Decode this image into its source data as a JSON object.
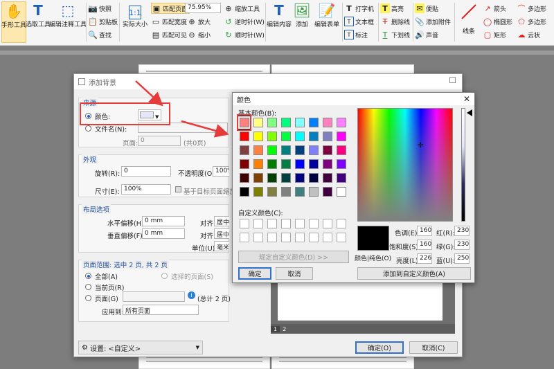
{
  "ribbon": {
    "hand": "手形工具",
    "select": "选取工具",
    "edit_annot": "编辑注释工具",
    "snapshot": "快照",
    "clipboard": "剪贴板",
    "find": "查找",
    "actual": "实际大小",
    "fit_page": "匹配页面",
    "fit_width": "匹配宽度",
    "fit_visible": "匹配可见",
    "zoom_val": "75.95%",
    "zoom_tool": "缩放工具",
    "zoom_in": "放大",
    "zoom_out": "缩小",
    "ccw": "逆时针(W)",
    "cw": "顺时针(W)",
    "edit_content": "编辑内容",
    "add": "添加",
    "edit_form": "编辑表单",
    "typewriter": "打字机",
    "textbox": "文本框",
    "callout": "标注",
    "highlight": "高亮",
    "strike": "删除线",
    "underline": "下划线",
    "note": "便贴",
    "attach": "添加附件",
    "sound": "声音",
    "line": "线条",
    "arrow": "箭头",
    "ellipse": "椭圆形",
    "rect": "矩形",
    "polygon": "多边形",
    "polyline": "多边形",
    "cloud": "云状"
  },
  "bg_dialog": {
    "title": "添加背景",
    "source": "来源",
    "color": "颜色:",
    "filename": "文件名(N):",
    "page": "页面:",
    "page_val": "0",
    "page_total": "(共0页)",
    "appearance": "外观",
    "rotate": "旋转(R):",
    "rotate_val": "0",
    "opacity": "不透明度(O):",
    "opacity_val": "100%",
    "size": "尺寸(E):",
    "size_val": "100%",
    "scale_target": "基于目标页面缩放",
    "layout": "布局选项",
    "hoffset": "水平偏移(H):",
    "hoffset_val": "0 mm",
    "voffset": "垂直偏移(F):",
    "voffset_val": "0 mm",
    "align1": "对齐:",
    "align1_val": "居中",
    "align2": "对齐:",
    "align2_val": "居中",
    "unit": "单位(U):",
    "unit_val": "毫米",
    "range": "页面范围: 选中 2 页, 共 2 页",
    "all": "全部(A)",
    "selected": "选择的页面(S)",
    "current": "当前页(R)",
    "pages": "页面(G)",
    "pages_total": "(总计 2 页)",
    "apply": "应用到:",
    "apply_val": "所有页面",
    "settings": "设置:",
    "settings_val": "<自定义>",
    "ok": "确定(O)",
    "cancel": "取消(C)",
    "thumb1": "1",
    "thumb2": "2"
  },
  "color_dialog": {
    "title": "颜色",
    "basic": "基本颜色(B):",
    "custom": "自定义颜色(C):",
    "define": "规定自定义颜色(D) >>",
    "ok": "确定",
    "cancel": "取消",
    "solid": "颜色|纯色(O)",
    "hue_l": "色调(E):",
    "hue": "160",
    "sat_l": "饱和度(S):",
    "sat": "160",
    "lum_l": "亮度(L):",
    "lum": "226",
    "red_l": "红(R):",
    "red": "230",
    "green_l": "绿(G):",
    "green": "230",
    "blue_l": "蓝(U):",
    "blue": "250",
    "add_custom": "添加到自定义颜色(A)",
    "swatches": [
      "#ff8080",
      "#ffff80",
      "#80ff80",
      "#00ff80",
      "#80ffff",
      "#0080ff",
      "#ff80c0",
      "#ff80ff",
      "#ff0000",
      "#ffff00",
      "#80ff00",
      "#00ff40",
      "#00ffff",
      "#0080c0",
      "#8080c0",
      "#ff00ff",
      "#804040",
      "#ff8040",
      "#00ff00",
      "#008080",
      "#004080",
      "#8080ff",
      "#800040",
      "#ff0080",
      "#800000",
      "#ff8000",
      "#008000",
      "#008040",
      "#0000ff",
      "#0000a0",
      "#800080",
      "#8000ff",
      "#400000",
      "#804000",
      "#004000",
      "#004040",
      "#000080",
      "#000040",
      "#400040",
      "#400080",
      "#000000",
      "#808000",
      "#808040",
      "#808080",
      "#408080",
      "#c0c0c0",
      "#400040",
      "#ffffff"
    ]
  },
  "colors": {
    "accent": "#2d6fd1",
    "annot_red": "#e53b3b",
    "selected_color": "#e6e6fa"
  }
}
